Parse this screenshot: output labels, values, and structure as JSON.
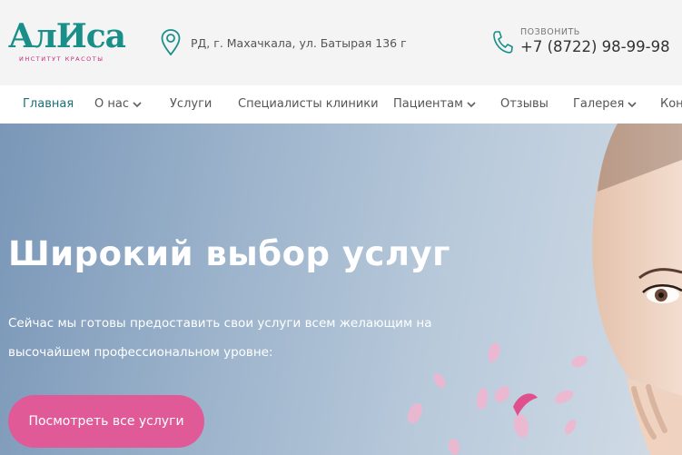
{
  "header": {
    "logo_text": "АлИса",
    "logo_subtitle": "ИНСТИТУТ КРАСОТЫ",
    "address": "РД, г. Махачкала, ул. Батырая 136 г",
    "phone_label": "ПОЗВОНИТЬ",
    "phone_number": "+7 (8722) 98-99-98",
    "pin_icon": "location-pin-icon",
    "phone_icon": "phone-icon"
  },
  "nav": {
    "items": [
      {
        "label": "Главная",
        "active": true
      },
      {
        "label": "О нас",
        "dropdown": true
      },
      {
        "label": "Услуги"
      },
      {
        "label": "Специалисты клиники"
      },
      {
        "label": "Пациентам",
        "dropdown": true
      },
      {
        "label": "Отзывы"
      },
      {
        "label": "Галерея",
        "dropdown": true
      },
      {
        "label": "Кон"
      }
    ]
  },
  "hero": {
    "title": "Широкий выбор услуг",
    "text": "Сейчас мы готовы предоставить свои услуги всем желающим на высочайшем профессиональном уровне:",
    "button_label": "Посмотреть все услуги"
  },
  "colors": {
    "brand_teal": "#1a8f8a",
    "brand_pink": "#c4287a",
    "button_pink": "#e05a97",
    "nav_active": "#1a6f77"
  }
}
